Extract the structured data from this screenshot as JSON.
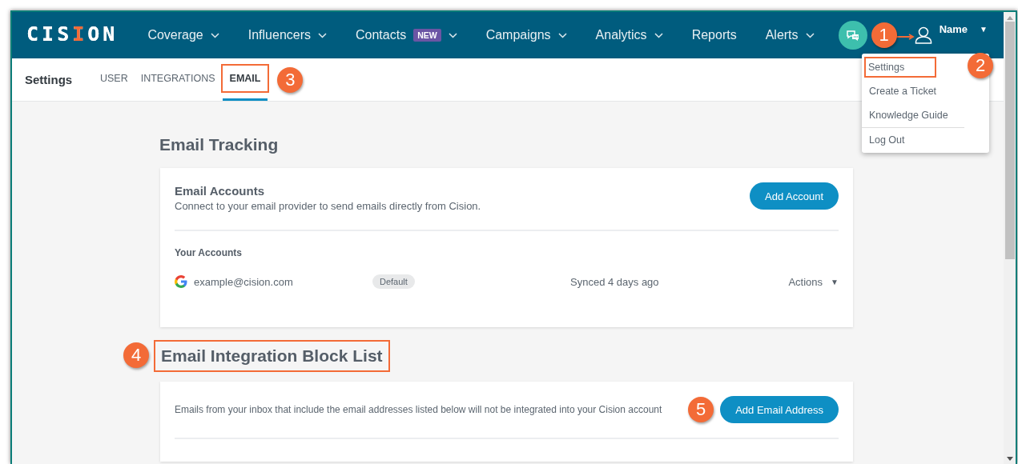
{
  "logo": "CISION",
  "nav": [
    {
      "label": "Coverage",
      "dropdown": true
    },
    {
      "label": "Influencers",
      "dropdown": true
    },
    {
      "label": "Contacts",
      "badge": "NEW",
      "dropdown": true
    },
    {
      "label": "Campaigns",
      "dropdown": true
    },
    {
      "label": "Analytics",
      "dropdown": true
    },
    {
      "label": "Reports",
      "dropdown": false
    },
    {
      "label": "Alerts",
      "dropdown": true
    }
  ],
  "user": {
    "name": "Name",
    "caret": "▼",
    "callout": "1"
  },
  "user_menu": [
    {
      "label": "Settings",
      "highlighted": true,
      "divider_before": false,
      "callout": "2"
    },
    {
      "label": "Create a Ticket",
      "highlighted": false,
      "divider_before": false
    },
    {
      "label": "Knowledge Guide",
      "highlighted": false,
      "divider_before": false
    },
    {
      "label": "Log Out",
      "highlighted": false,
      "divider_before": true
    }
  ],
  "page_title": "Settings",
  "tabs": [
    {
      "label": "USER",
      "selected": false,
      "highlighted": false
    },
    {
      "label": "INTEGRATIONS",
      "selected": false,
      "highlighted": false
    },
    {
      "label": "EMAIL",
      "selected": true,
      "highlighted": true,
      "callout": "3"
    }
  ],
  "email_tracking": {
    "title": "Email Tracking",
    "highlighted": false,
    "card_title": "Email Accounts",
    "description": "Connect to your email provider to send emails directly from Cision.",
    "button": "Add Account",
    "list_title": "Your Accounts",
    "accounts": [
      {
        "email": "example@cision.com",
        "badge": "Default",
        "synced": "Synced 4 days ago",
        "actions": "Actions",
        "caret": "▼"
      }
    ]
  },
  "block_list": {
    "title": "Email Integration Block List",
    "highlighted": true,
    "callout": "4",
    "description": "Emails from your inbox that include the email addresses listed below will not be integrated into your Cision account",
    "button": "Add Email Address",
    "button_callout": "5"
  }
}
